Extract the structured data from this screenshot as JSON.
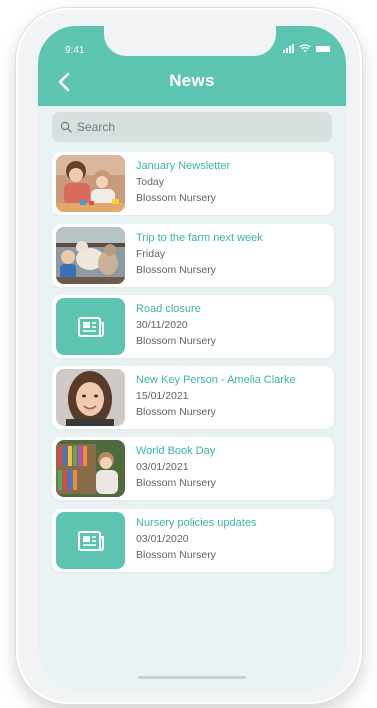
{
  "status_bar": {
    "time": "9:41"
  },
  "header": {
    "title": "News",
    "back_icon": "chevron-left-icon"
  },
  "search": {
    "placeholder": "Search",
    "icon": "search-icon"
  },
  "news_items": [
    {
      "title": "January Newsletter",
      "date": "Today",
      "source": "Blossom Nursery",
      "thumbnail": "photo-children-playing"
    },
    {
      "title": "Trip to the farm next week",
      "date": "Friday",
      "source": "Blossom Nursery",
      "thumbnail": "photo-farm-goats"
    },
    {
      "title": "Road closure",
      "date": "30/11/2020",
      "source": "Blossom Nursery",
      "thumbnail": "newspaper-icon"
    },
    {
      "title": "New Key Person - Amelia Clarke",
      "date": "15/01/2021",
      "source": "Blossom Nursery",
      "thumbnail": "photo-portrait"
    },
    {
      "title": "World Book Day",
      "date": "03/01/2021",
      "source": "Blossom Nursery",
      "thumbnail": "photo-child-bookshelf"
    },
    {
      "title": "Nursery policies updates",
      "date": "03/01/2020",
      "source": "Blossom Nursery",
      "thumbnail": "newspaper-icon"
    }
  ],
  "colors": {
    "accent": "#5ec4b2",
    "title_text": "#3fb4a1",
    "background": "#eaf3f3"
  }
}
